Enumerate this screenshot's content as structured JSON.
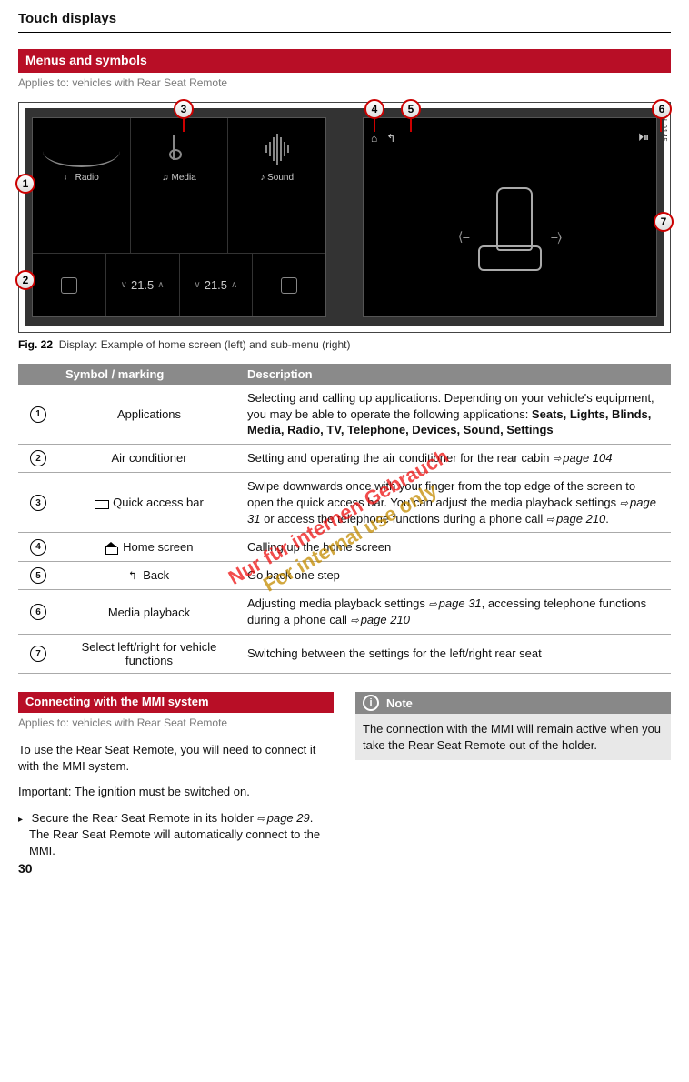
{
  "page": {
    "title": "Touch displays",
    "number": "30"
  },
  "menus_section": {
    "heading": "Menus and symbols",
    "applies": "Applies to: vehicles with Rear Seat Remote"
  },
  "figure": {
    "ref_code": "RAH-9145",
    "tiles": {
      "radio": "Radio",
      "media": "Media",
      "sound": "Sound"
    },
    "climate": {
      "temp_left": "21.5",
      "temp_right": "21.5"
    },
    "callouts": {
      "c1": "1",
      "c2": "2",
      "c3": "3",
      "c4": "4",
      "c5": "5",
      "c6": "6",
      "c7": "7"
    },
    "caption_label": "Fig. 22",
    "caption_text": "Display: Example of home screen (left) and sub-menu (right)"
  },
  "table": {
    "head_symbol": "Symbol / marking",
    "head_desc": "Description",
    "rows": [
      {
        "num": "1",
        "symbol_label": "Applications",
        "desc_pre": "Selecting and calling up applications. Depending on your vehicle's equipment, you may be able to operate the following applications: ",
        "desc_bold": "Seats, Lights, Blinds, Media, Radio, TV, Telephone, Devices, Sound, Settings"
      },
      {
        "num": "2",
        "symbol_label": "Air conditioner",
        "desc": "Setting and operating the air conditioner for the rear cabin ",
        "page_ref": "page 104"
      },
      {
        "num": "3",
        "symbol_label": "Quick access bar",
        "desc_a": "Swipe downwards once with your finger from the top edge of the screen to open the quick access bar. You can adjust the media playback settings ",
        "page_ref_a": "page 31",
        "desc_b": " or access the telephone functions during a phone call ",
        "page_ref_b": "page 210",
        "desc_c": "."
      },
      {
        "num": "4",
        "symbol_label": "Home screen",
        "desc": "Calling up the home screen"
      },
      {
        "num": "5",
        "symbol_label": "Back",
        "desc": "Go back one step"
      },
      {
        "num": "6",
        "symbol_label": "Media playback",
        "desc_a": "Adjusting media playback settings ",
        "page_ref_a": "page 31",
        "desc_b": ", accessing telephone functions during a phone call ",
        "page_ref_b": "page 210"
      },
      {
        "num": "7",
        "symbol_label": "Select left/right for vehicle functions",
        "desc": "Switching between the settings for the left/right rear seat"
      }
    ]
  },
  "connecting": {
    "heading": "Connecting with the MMI system",
    "applies": "Applies to: vehicles with Rear Seat Remote",
    "para1": "To use the Rear Seat Remote, you will need to connect it with the MMI system.",
    "para2": "Important: The ignition must be switched on.",
    "step1_a": "Secure the Rear Seat Remote in its holder ",
    "step1_ref": "page 29",
    "step1_b": ". The Rear Seat Remote will automatically connect to the MMI."
  },
  "note": {
    "heading": "Note",
    "body": "The connection with the MMI will remain active when you take the Rear Seat Remote out of the holder."
  },
  "watermark": {
    "line1": "Nur für internen Gebrauch",
    "line2": "For internal use only"
  }
}
